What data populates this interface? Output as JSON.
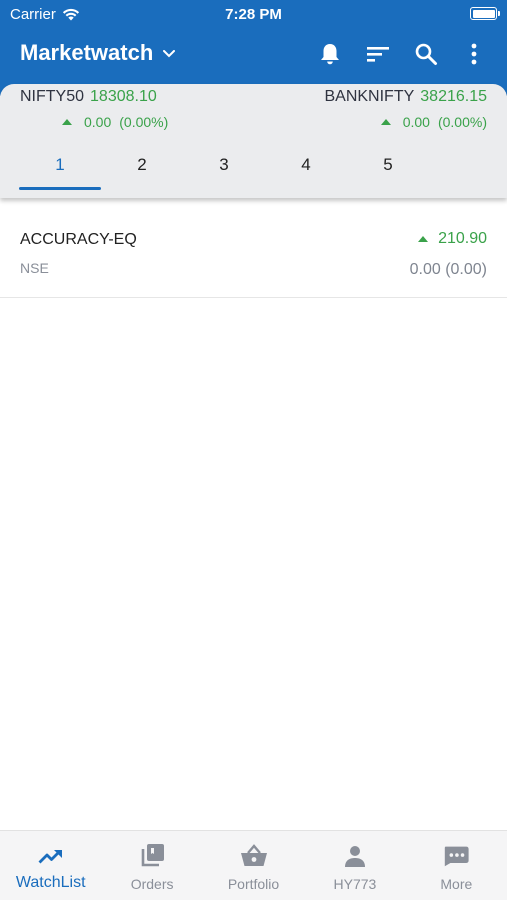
{
  "status_bar": {
    "carrier": "Carrier",
    "time": "7:28 PM"
  },
  "header": {
    "title": "Marketwatch"
  },
  "indices": [
    {
      "name": "NIFTY50",
      "value": "18308.10",
      "change": "0.00",
      "change_pct": "(0.00%)"
    },
    {
      "name": "BANKNIFTY",
      "value": "38216.15",
      "change": "0.00",
      "change_pct": "(0.00%)"
    }
  ],
  "tabs": [
    {
      "label": "1",
      "active": true
    },
    {
      "label": "2"
    },
    {
      "label": "3"
    },
    {
      "label": "4"
    },
    {
      "label": "5"
    }
  ],
  "watchlist": [
    {
      "symbol": "ACCURACY-EQ",
      "exchange": "NSE",
      "ltp": "210.90",
      "change": "0.00 (0.00)"
    }
  ],
  "bottom_nav": [
    {
      "label": "WatchList",
      "icon": "trending-up-icon",
      "active": true
    },
    {
      "label": "Orders",
      "icon": "orders-stack-icon"
    },
    {
      "label": "Portfolio",
      "icon": "basket-icon"
    },
    {
      "label": "HY773",
      "icon": "person-icon"
    },
    {
      "label": "More",
      "icon": "more-chat-icon"
    }
  ],
  "colors": {
    "primary": "#1a6dbd",
    "positive": "#3aa24a",
    "muted": "#8a8f99",
    "card_bg": "#ebecee"
  }
}
